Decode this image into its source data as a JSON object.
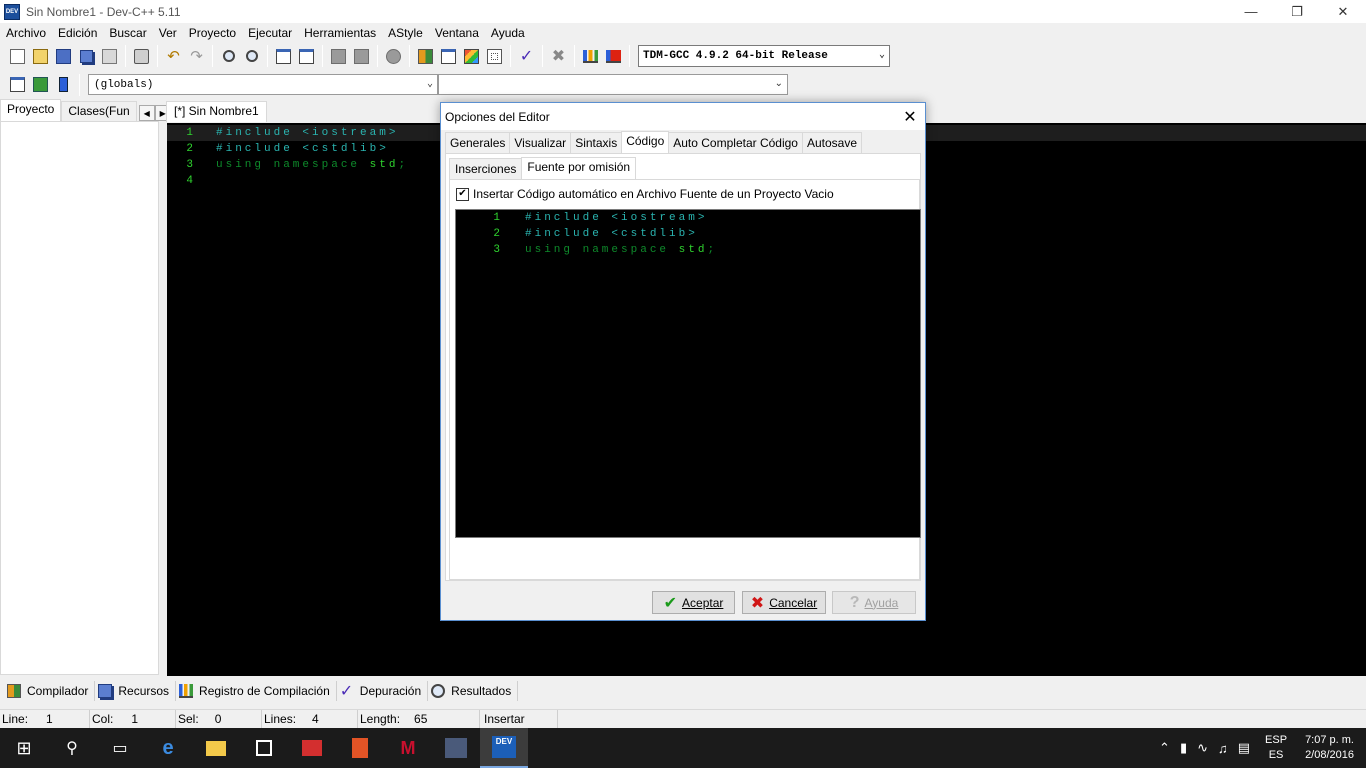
{
  "window": {
    "title": "Sin Nombre1 - Dev-C++ 5.11",
    "icon_text": "DEV"
  },
  "menu": [
    "Archivo",
    "Edición",
    "Buscar",
    "Ver",
    "Proyecto",
    "Ejecutar",
    "Herramientas",
    "AStyle",
    "Ventana",
    "Ayuda"
  ],
  "toolbar": {
    "compiler": "TDM-GCC 4.9.2 64-bit Release",
    "scope": "(globals)",
    "symbol": ""
  },
  "left_panel": {
    "tabs": [
      "Proyecto",
      "Clases(Fun"
    ]
  },
  "editor": {
    "tab": "[*] Sin Nombre1",
    "lines": [
      {
        "num": "1",
        "parts": [
          {
            "t": "#include <iostream>",
            "c": "pre"
          }
        ]
      },
      {
        "num": "2",
        "parts": [
          {
            "t": "#include <cstdlib>",
            "c": "pre"
          }
        ]
      },
      {
        "num": "3",
        "parts": [
          {
            "t": "using namespace ",
            "c": "key"
          },
          {
            "t": "std",
            "c": "norm"
          },
          {
            "t": ";",
            "c": "key"
          }
        ]
      },
      {
        "num": "4",
        "parts": []
      }
    ]
  },
  "dialog": {
    "title": "Opciones del Editor",
    "tabs": [
      "Generales",
      "Visualizar",
      "Sintaxis",
      "Código",
      "Auto Completar Código",
      "Autosave"
    ],
    "active_tab": "Código",
    "subtabs": [
      "Inserciones",
      "Fuente por omisión"
    ],
    "active_subtab": "Fuente por omisión",
    "checkbox_label": "Insertar Código automático en Archivo Fuente de un Proyecto Vacio",
    "checkbox_checked": true,
    "code_lines": [
      {
        "num": "1",
        "parts": [
          {
            "t": "#include <iostream>",
            "c": "pre"
          }
        ]
      },
      {
        "num": "2",
        "parts": [
          {
            "t": "#include <cstdlib>",
            "c": "pre"
          }
        ]
      },
      {
        "num": "3",
        "parts": [
          {
            "t": "using namespace ",
            "c": "key"
          },
          {
            "t": "std",
            "c": "norm"
          },
          {
            "t": ";",
            "c": "key"
          }
        ]
      }
    ],
    "buttons": {
      "ok": "Aceptar",
      "cancel": "Cancelar",
      "help": "Ayuda"
    }
  },
  "bottom_tabs": [
    "Compilador",
    "Recursos",
    "Registro de Compilación",
    "Depuración",
    "Resultados"
  ],
  "status": {
    "line_label": "Line:",
    "line": "1",
    "col_label": "Col:",
    "col": "1",
    "sel_label": "Sel:",
    "sel": "0",
    "lines_label": "Lines:",
    "lines": "4",
    "length_label": "Length:",
    "length": "65",
    "mode": "Insertar"
  },
  "taskbar": {
    "lang_top": "ESP",
    "lang_bottom": "ES",
    "time": "7:07 p. m.",
    "date": "2/08/2016"
  },
  "colors": {
    "pre": "#2ab4b0",
    "key": "#0e8a2b",
    "norm": "#2fd42f",
    "accent": "#5a8fd0"
  }
}
